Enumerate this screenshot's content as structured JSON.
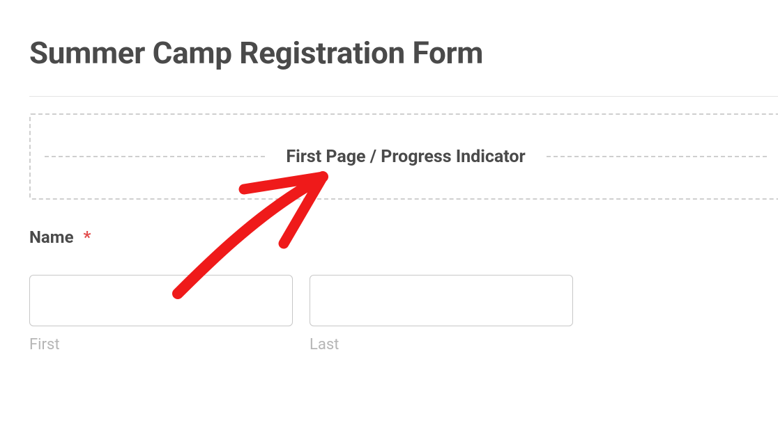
{
  "form": {
    "title": "Summer Camp Registration Form",
    "indicator_label": "First Page / Progress Indicator"
  },
  "fields": {
    "name": {
      "label": "Name",
      "required_marker": "*",
      "first": {
        "sub_label": "First",
        "value": ""
      },
      "last": {
        "sub_label": "Last",
        "value": ""
      }
    }
  },
  "annotation": {
    "arrow_color": "#ef1a1a"
  }
}
